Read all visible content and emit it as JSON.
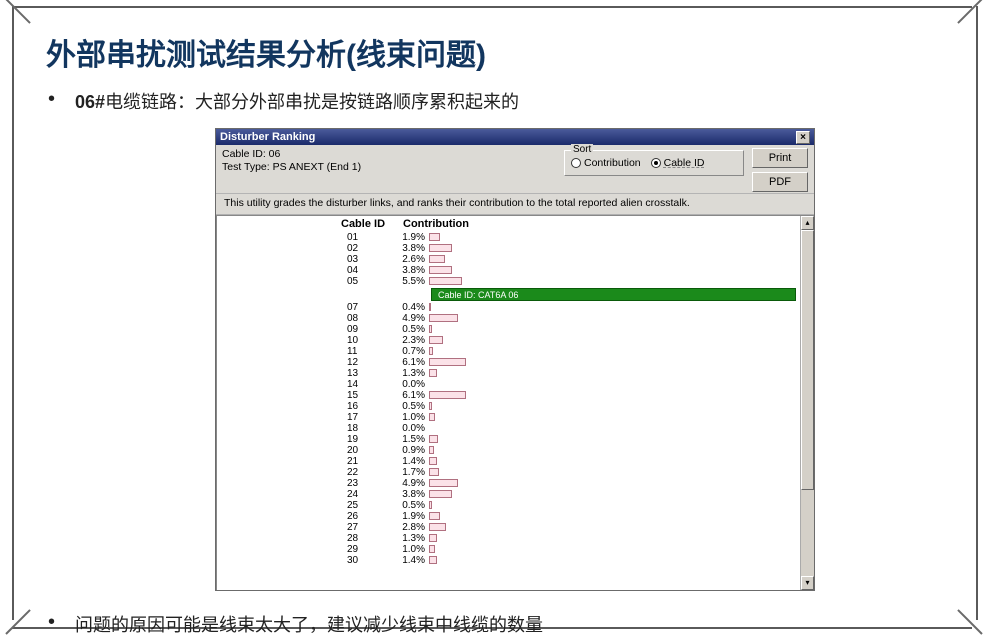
{
  "slide": {
    "title": "外部串扰测试结果分析(线束问题)",
    "bullet1_strong": "06#",
    "bullet1_rest": "电缆链路：大部分外部串扰是按链路顺序累积起来的",
    "bullet2": "问题的原因可能是线束太大了，建议减少线束中线缆的数量"
  },
  "win": {
    "title": "Disturber Ranking",
    "close": "×",
    "cable_line": "Cable ID: 06",
    "test_line": "Test Type: PS ANEXT (End 1)",
    "sort_legend": "Sort",
    "radio_contribution": "Contribution",
    "radio_cableid": "Cable ID",
    "btn_print": "Print",
    "btn_pdf": "PDF",
    "utility": "This utility grades the disturber links, and ranks their contribution to the total reported alien crosstalk."
  },
  "list": {
    "hdr_id": "Cable ID",
    "hdr_contrib": "Contribution",
    "selected_label": "Cable ID: CAT6A 06"
  },
  "chart_data": {
    "type": "bar",
    "xlabel": "Contribution",
    "ylabel": "Cable ID",
    "xlim": [
      0,
      6.5
    ],
    "rows": [
      {
        "id": "01",
        "value": 1.9
      },
      {
        "id": "02",
        "value": 3.8
      },
      {
        "id": "03",
        "value": 2.6
      },
      {
        "id": "04",
        "value": 3.8
      },
      {
        "id": "05",
        "value": 5.5
      },
      {
        "id": "07",
        "value": 0.4
      },
      {
        "id": "08",
        "value": 4.9
      },
      {
        "id": "09",
        "value": 0.5
      },
      {
        "id": "10",
        "value": 2.3
      },
      {
        "id": "11",
        "value": 0.7
      },
      {
        "id": "12",
        "value": 6.1
      },
      {
        "id": "13",
        "value": 1.3
      },
      {
        "id": "14",
        "value": 0.0
      },
      {
        "id": "15",
        "value": 6.1
      },
      {
        "id": "16",
        "value": 0.5
      },
      {
        "id": "17",
        "value": 1.0
      },
      {
        "id": "18",
        "value": 0.0
      },
      {
        "id": "19",
        "value": 1.5
      },
      {
        "id": "20",
        "value": 0.9
      },
      {
        "id": "21",
        "value": 1.4
      },
      {
        "id": "22",
        "value": 1.7
      },
      {
        "id": "23",
        "value": 4.9
      },
      {
        "id": "24",
        "value": 3.8
      },
      {
        "id": "25",
        "value": 0.5
      },
      {
        "id": "26",
        "value": 1.9
      },
      {
        "id": "27",
        "value": 2.8
      },
      {
        "id": "28",
        "value": 1.3
      },
      {
        "id": "29",
        "value": 1.0
      },
      {
        "id": "30",
        "value": 1.4
      }
    ],
    "selected_after_index": 5
  }
}
